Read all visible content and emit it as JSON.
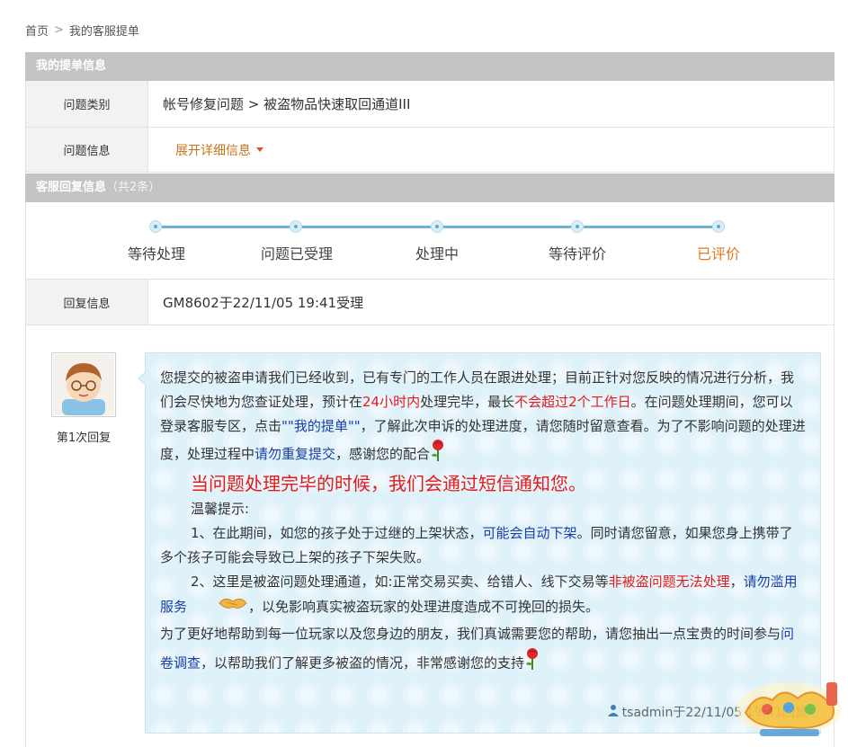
{
  "breadcrumb": {
    "home": "首页",
    "separator": ">",
    "current": "我的客服提单"
  },
  "ticket_info": {
    "header": "我的提单信息",
    "category_label": "问题类别",
    "category_value": "帐号修复问题 > 被盗物品快速取回通道III",
    "info_label": "问题信息",
    "expand_label": "展开详细信息"
  },
  "replies": {
    "header": "客服回复信息",
    "count": "（共2条）",
    "steps": [
      "等待处理",
      "问题已受理",
      "处理中",
      "等待评价",
      "已评价"
    ],
    "active_step": 4,
    "reply_info_label": "回复信息",
    "reply_info_value": "GM8602于22/11/05 19:41受理"
  },
  "reply1": {
    "label": "第1次回复",
    "p1_a": "您提交的被盗申请我们已经收到，已有专门的工作人员在跟进处理；目前正针对您反映的情况进行分析，我们会尽快地为您查证处理，预计在",
    "p1_red1": "24小时内",
    "p1_b": "处理完毕，最长",
    "p1_red2": "不会超过2个工作日",
    "p1_c": "。在问题处理期间，您可以登录客服专区，点击",
    "p1_blue1": "\"\"我的提单\"\"",
    "p1_d": "，了解此次申诉的处理进度，请您随时留意查看。为了不影响问题的处理进度，处理过程中",
    "p1_blue2": "请勿重复提交",
    "p1_e": "，感谢您的配合",
    "notice": "当问题处理完毕的时候，我们会通过短信通知您。",
    "tip_title": "温馨提示:",
    "tip1_a": "1、在此期间，如您的孩子处于过继的上架状态，",
    "tip1_blue": "可能会自动下架",
    "tip1_b": "。同时请您留意，如果您身上携带了多个孩子可能会导致已上架的孩子下架失败。",
    "tip2_a": "2、这里是被盗问题处理通道，如:正常交易买卖、给错人、线下交易等",
    "tip2_red": "非被盗问题无法处理",
    "tip2_b": "，",
    "tip2_blue": "请勿滥用服务",
    "tip2_c": "，以免影响真实被盗玩家的处理进度造成不可挽回的损失。",
    "closing_a": "为了更好地帮助到每一位玩家以及您身边的朋友，我们真诚需要您的帮助，请您抽出一点宝贵的时间参与",
    "closing_blue": "问卷调查",
    "closing_b": "，以帮助我们了解更多被盗的情况，非常感谢您的支持",
    "signature": "tsadmin于22/11/05 19:41回复"
  },
  "colors": {
    "accent_orange": "#e07a1f",
    "red": "#e31b1b",
    "blue": "#1a3fa8",
    "bubble": "#dff1f9",
    "header_gray": "#c4c4c4"
  },
  "icons": [
    "chevron-right-icon",
    "caret-down-icon",
    "avatar-boy-icon",
    "rose-icon",
    "handshake-icon",
    "user-icon",
    "game-logo-watermark"
  ]
}
